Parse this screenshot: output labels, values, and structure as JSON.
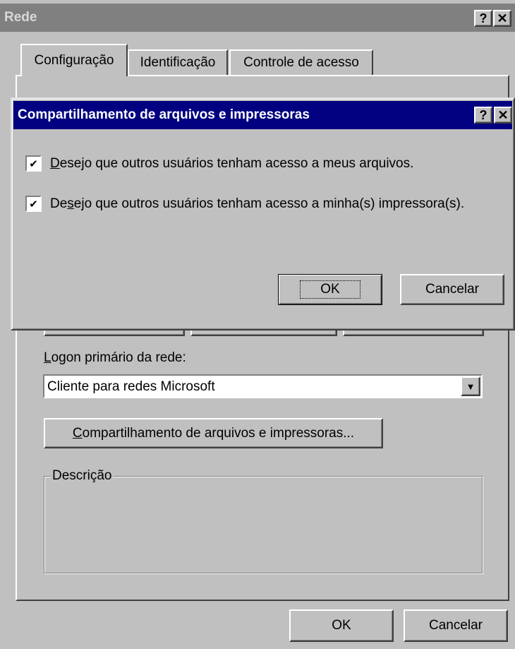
{
  "outer_window": {
    "title": "Rede",
    "tabs": [
      {
        "label": "Configuração",
        "active": true
      },
      {
        "label": "Identificação",
        "active": false
      },
      {
        "label": "Controle de acesso",
        "active": false
      }
    ],
    "primary_logon_label_pre": "",
    "primary_logon_label_u": "L",
    "primary_logon_label_post": "ogon primário da rede:",
    "primary_logon_value": "Cliente para redes Microsoft",
    "share_button_pre": "",
    "share_button_u": "C",
    "share_button_post": "ompartilhamento de arquivos e impressoras...",
    "description_legend": "Descrição",
    "ok_label": "OK",
    "cancel_label": "Cancelar"
  },
  "dialog": {
    "title": "Compartilhamento de arquivos e impressoras",
    "options": [
      {
        "pre": "",
        "u": "D",
        "post": "esejo que outros usuários tenham acesso a meus arquivos.",
        "checked": true
      },
      {
        "pre": "De",
        "u": "s",
        "post": "ejo que outros usuários tenham acesso a minha(s) impressora(s).",
        "checked": true
      }
    ],
    "ok_label": "OK",
    "cancel_label": "Cancelar"
  },
  "colors": {
    "face": "#c0c0c0",
    "active_title": "#000080",
    "inactive_title": "#808080"
  },
  "icons": {
    "help": "?",
    "close": "✕",
    "dropdown": "▼",
    "check": "✔"
  }
}
